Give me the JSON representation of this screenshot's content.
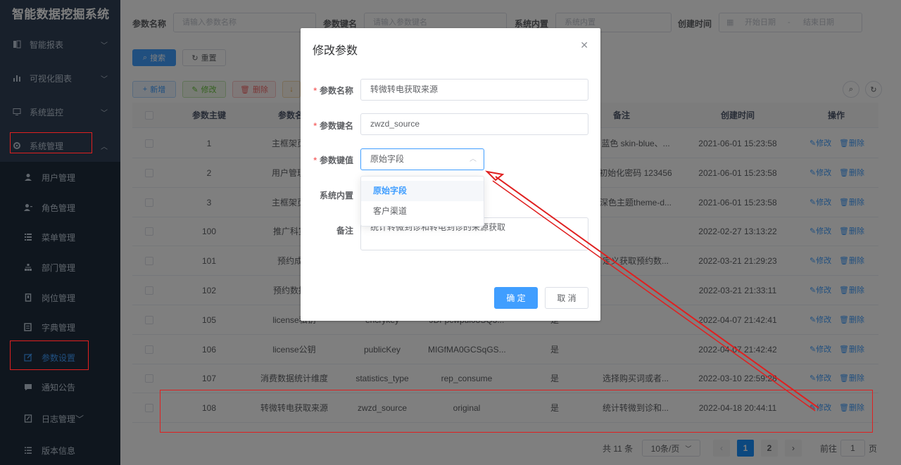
{
  "app": {
    "title": "智能数据挖掘系统"
  },
  "sidebar": {
    "items": [
      {
        "label": "智能报表",
        "icon": "report-icon"
      },
      {
        "label": "可视化图表",
        "icon": "chart-icon"
      },
      {
        "label": "系统监控",
        "icon": "monitor-icon"
      },
      {
        "label": "系统管理",
        "icon": "gear-icon"
      }
    ],
    "submenu": [
      {
        "label": "用户管理",
        "icon": "user-icon"
      },
      {
        "label": "角色管理",
        "icon": "role-icon"
      },
      {
        "label": "菜单管理",
        "icon": "menu-icon"
      },
      {
        "label": "部门管理",
        "icon": "tree-icon"
      },
      {
        "label": "岗位管理",
        "icon": "post-icon"
      },
      {
        "label": "字典管理",
        "icon": "dict-icon"
      },
      {
        "label": "参数设置",
        "icon": "edit-icon"
      },
      {
        "label": "通知公告",
        "icon": "message-icon"
      },
      {
        "label": "日志管理",
        "icon": "log-icon"
      },
      {
        "label": "版本信息",
        "icon": "list-icon"
      }
    ]
  },
  "search": {
    "name_label": "参数名称",
    "name_placeholder": "请输入参数名称",
    "key_label": "参数键名",
    "key_placeholder": "请输入参数键名",
    "builtin_label": "系统内置",
    "builtin_placeholder": "系统内置",
    "date_label": "创建时间",
    "date_start": "开始日期",
    "date_sep": "-",
    "date_end": "结束日期",
    "search_btn": "搜索",
    "reset_btn": "重置"
  },
  "toolbar": {
    "add": "新增",
    "edit": "修改",
    "delete": "删除"
  },
  "table": {
    "headers": [
      "参数主键",
      "参数名",
      "",
      "",
      "",
      "备注",
      "创建时间",
      "操作"
    ],
    "rows": [
      {
        "id": "1",
        "name": "主框架页-默",
        "key": "",
        "value": "",
        "builtin": "",
        "remark": "蓝色 skin-blue、...",
        "created": "2021-06-01 15:23:58"
      },
      {
        "id": "2",
        "name": "用户管理-账",
        "key": "",
        "value": "",
        "builtin": "",
        "remark": "初始化密码 123456",
        "created": "2021-06-01 15:23:58"
      },
      {
        "id": "3",
        "name": "主框架页-侧",
        "key": "",
        "value": "",
        "builtin": "",
        "remark": "深色主题theme-d...",
        "created": "2021-06-01 15:23:58"
      },
      {
        "id": "100",
        "name": "推广科室取",
        "key": "",
        "value": "",
        "builtin": "",
        "remark": "",
        "created": "2022-02-27 13:13:22"
      },
      {
        "id": "101",
        "name": "预约成功",
        "key": "",
        "value": "",
        "builtin": "",
        "remark": "定义获取预约数...",
        "created": "2022-03-21 21:29:23"
      },
      {
        "id": "102",
        "name": "预约数据的",
        "key": "",
        "value": "",
        "builtin": "",
        "remark": "",
        "created": "2022-03-21 21:33:11"
      },
      {
        "id": "105",
        "name": "license私钥",
        "key": "encrykey",
        "value": "JDFpcwpul08SQ3...",
        "builtin": "是",
        "remark": "",
        "created": "2022-04-07 21:42:41"
      },
      {
        "id": "106",
        "name": "license公钥",
        "key": "publicKey",
        "value": "MIGfMA0GCSqGS...",
        "builtin": "是",
        "remark": "",
        "created": "2022-04-07 21:42:42"
      },
      {
        "id": "107",
        "name": "消费数据统计维度",
        "key": "statistics_type",
        "value": "rep_consume",
        "builtin": "是",
        "remark": "选择购买词或者...",
        "created": "2022-03-10 22:59:28"
      },
      {
        "id": "108",
        "name": "转微转电获取来源",
        "key": "zwzd_source",
        "value": "original",
        "builtin": "是",
        "remark": "统计转微到诊和...",
        "created": "2022-04-18 20:44:11"
      }
    ],
    "edit_label": "修改",
    "delete_label": "删除"
  },
  "pagination": {
    "total": "共 11 条",
    "page_size": "10条/页",
    "pages": [
      "1",
      "2"
    ],
    "goto_label": "前往",
    "goto_value": "1",
    "page_suffix": "页"
  },
  "dialog": {
    "title": "修改参数",
    "fields": {
      "name_label": "参数名称",
      "name_value": "转微转电获取来源",
      "key_label": "参数键名",
      "key_value": "zwzd_source",
      "value_label": "参数键值",
      "value_value": "原始字段",
      "builtin_label": "系统内置",
      "remark_label": "备注",
      "remark_value": "统计转微到诊和转电到诊的来源获取"
    },
    "options": [
      "原始字段",
      "客户渠道"
    ],
    "confirm": "确 定",
    "cancel": "取 消"
  },
  "colors": {
    "primary": "#409eff",
    "sidebar": "#304156",
    "annotation": "#e02020"
  }
}
